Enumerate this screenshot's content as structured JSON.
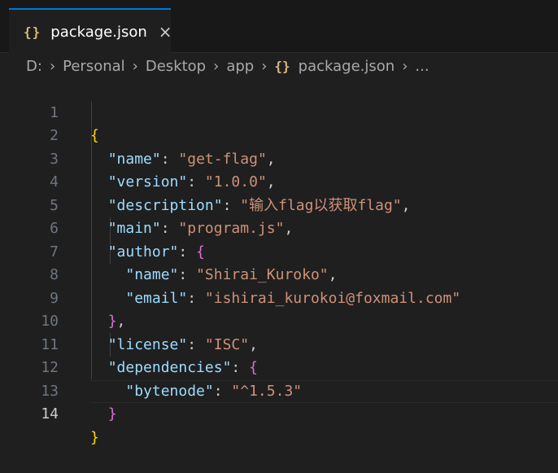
{
  "tab": {
    "icon": "{}",
    "label": "package.json",
    "close": "×"
  },
  "breadcrumb": {
    "items": [
      "D:",
      "Personal",
      "Desktop",
      "app"
    ],
    "file_icon": "{}",
    "file": "package.json",
    "more": "..."
  },
  "editor": {
    "active_line": 14,
    "lines": [
      {
        "n": "1"
      },
      {
        "n": "2"
      },
      {
        "n": "3"
      },
      {
        "n": "4"
      },
      {
        "n": "5"
      },
      {
        "n": "6"
      },
      {
        "n": "7"
      },
      {
        "n": "8"
      },
      {
        "n": "9"
      },
      {
        "n": "10"
      },
      {
        "n": "11"
      },
      {
        "n": "12"
      },
      {
        "n": "13"
      },
      {
        "n": "14"
      }
    ],
    "json": {
      "open": "{",
      "close": "}",
      "name_key": "\"name\"",
      "name_val": "\"get-flag\"",
      "version_key": "\"version\"",
      "version_val": "\"1.0.0\"",
      "description_key": "\"description\"",
      "description_val": "\"输入flag以获取flag\"",
      "main_key": "\"main\"",
      "main_val": "\"program.js\"",
      "author_key": "\"author\"",
      "author_name_key": "\"name\"",
      "author_name_val": "\"Shirai_Kuroko\"",
      "author_email_key": "\"email\"",
      "author_email_val": "\"ishirai_kurokoi@foxmail.com\"",
      "license_key": "\"license\"",
      "license_val": "\"ISC\"",
      "dependencies_key": "\"dependencies\"",
      "bytenode_key": "\"bytenode\"",
      "bytenode_val": "\"^1.5.3\""
    }
  },
  "colors": {
    "key": "#9cdcfe",
    "string": "#ce9178",
    "bracket_level1": "#ffd700",
    "bracket_level2": "#da70d6",
    "tab_accent": "#0078d4",
    "json_icon": "#d7ba7d"
  }
}
